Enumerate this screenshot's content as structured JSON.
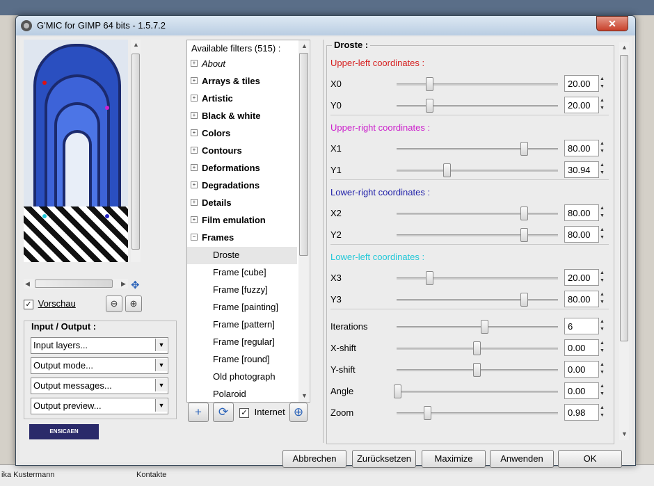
{
  "window": {
    "title": "G'MIC for GIMP 64 bits - 1.5.7.2",
    "close": "✕"
  },
  "background": {
    "left_text": "ika Kustermann",
    "right_text": "Kontakte"
  },
  "preview": {
    "checkbox": "✓",
    "label": "Vorschau",
    "zoom_out": "⊖",
    "zoom_in": "⊕",
    "move": "✥"
  },
  "io": {
    "title": "Input / Output :",
    "combos": [
      "Input layers...",
      "Output mode...",
      "Output messages...",
      "Output preview..."
    ]
  },
  "logo": "ENSICAEN",
  "filters": {
    "header": "Available filters (515) :",
    "items": [
      {
        "label": "About",
        "type": "cat",
        "exp": "+"
      },
      {
        "label": "Arrays & tiles",
        "type": "cat",
        "exp": "+"
      },
      {
        "label": "Artistic",
        "type": "cat",
        "exp": "+"
      },
      {
        "label": "Black & white",
        "type": "cat",
        "exp": "+"
      },
      {
        "label": "Colors",
        "type": "cat",
        "exp": "+"
      },
      {
        "label": "Contours",
        "type": "cat",
        "exp": "+"
      },
      {
        "label": "Deformations",
        "type": "cat",
        "exp": "+"
      },
      {
        "label": "Degradations",
        "type": "cat",
        "exp": "+"
      },
      {
        "label": "Details",
        "type": "cat",
        "exp": "+"
      },
      {
        "label": "Film emulation",
        "type": "cat",
        "exp": "+"
      },
      {
        "label": "Frames",
        "type": "cat",
        "exp": "−"
      },
      {
        "label": "Droste",
        "type": "sub",
        "exp": ""
      },
      {
        "label": "Frame [cube]",
        "type": "sub",
        "exp": ""
      },
      {
        "label": "Frame [fuzzy]",
        "type": "sub",
        "exp": ""
      },
      {
        "label": "Frame [painting]",
        "type": "sub",
        "exp": ""
      },
      {
        "label": "Frame [pattern]",
        "type": "sub",
        "exp": ""
      },
      {
        "label": "Frame [regular]",
        "type": "sub",
        "exp": ""
      },
      {
        "label": "Frame [round]",
        "type": "sub",
        "exp": ""
      },
      {
        "label": "Old photograph",
        "type": "sub",
        "exp": ""
      },
      {
        "label": "Polaroid",
        "type": "sub",
        "exp": ""
      }
    ],
    "toolbar": {
      "add": "+",
      "refresh": "⟳",
      "internet_check": "✓",
      "internet_label": "Internet",
      "zoom": "⊕"
    }
  },
  "params": {
    "title": "Droste :",
    "sections": [
      {
        "label": "Upper-left coordinates :",
        "color": "#d62020"
      },
      {
        "label": "Upper-right coordinates :",
        "color": "#cc22cc"
      },
      {
        "label": "Lower-right coordinates :",
        "color": "#2222aa"
      },
      {
        "label": "Lower-left coordinates :",
        "color": "#22c8d8"
      }
    ],
    "rows": [
      {
        "label": "X0",
        "value": "20.00",
        "level": 0.2
      },
      {
        "label": "Y0",
        "value": "20.00",
        "level": 0.2
      },
      {
        "label": "X1",
        "value": "80.00",
        "level": 0.8
      },
      {
        "label": "Y1",
        "value": "30.94",
        "level": 0.3094
      },
      {
        "label": "X2",
        "value": "80.00",
        "level": 0.8
      },
      {
        "label": "Y2",
        "value": "80.00",
        "level": 0.8
      },
      {
        "label": "X3",
        "value": "20.00",
        "level": 0.2
      },
      {
        "label": "Y3",
        "value": "80.00",
        "level": 0.8
      },
      {
        "label": "Iterations",
        "value": "6",
        "level": 0.55
      },
      {
        "label": "X-shift",
        "value": "0.00",
        "level": 0.5
      },
      {
        "label": "Y-shift",
        "value": "0.00",
        "level": 0.5
      },
      {
        "label": "Angle",
        "value": "0.00",
        "level": 0.0
      },
      {
        "label": "Zoom",
        "value": "0.98",
        "level": 0.19
      }
    ]
  },
  "buttons": {
    "cancel": "Abbrechen",
    "reset": "Zurücksetzen",
    "maximize": "Maximize",
    "apply": "Anwenden",
    "ok": "OK"
  }
}
